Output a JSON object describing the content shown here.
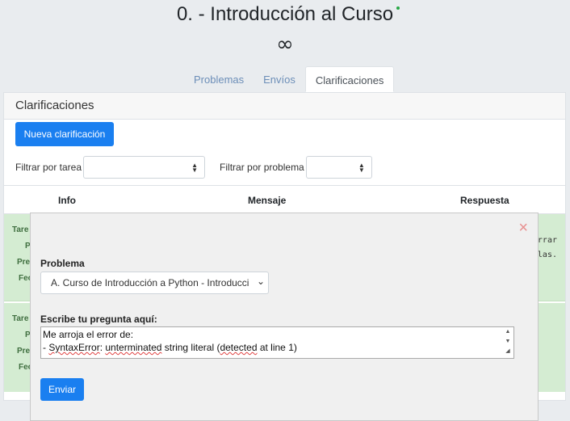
{
  "header": {
    "course_title": "0. - Introducción al Curso",
    "timer": "∞"
  },
  "tabs": [
    {
      "label": "Problemas",
      "active": false
    },
    {
      "label": "Envíos",
      "active": false
    },
    {
      "label": "Clarificaciones",
      "active": true
    }
  ],
  "panel": {
    "title": "Clarificaciones",
    "new_button": "Nueva clarificación",
    "filter_task_label": "Filtrar por tarea",
    "filter_problem_label": "Filtrar por problema"
  },
  "table": {
    "columns": [
      "Info",
      "Mensaje",
      "Respuesta"
    ],
    "rows": [
      {
        "labels": [
          "Tare",
          "P",
          "Pre",
          "Fec"
        ],
        "response": [
          "rrar",
          "las."
        ]
      },
      {
        "labels": [
          "Tare",
          "P",
          "Pre",
          "Fec"
        ],
        "response": []
      }
    ]
  },
  "modal": {
    "close_icon": "×",
    "problem_label": "Problema",
    "problem_value": "A. Curso de Introducción a Python - Introducci",
    "question_label": "Escribe tu pregunta aquí:",
    "question_line1": "Me arroja el error de:",
    "question_line2_prefix": "- ",
    "question_line2_word1": "SyntaxError",
    "question_line2_mid1": ": ",
    "question_line2_word2": "unterminated",
    "question_line2_mid2": " string literal (",
    "question_line2_word3": "detected",
    "question_line2_suffix": " at line 1)",
    "send_button": "Enviar"
  },
  "colors": {
    "primary": "#1a7ff0",
    "row_success": "#d4ecd2",
    "online": "#28a745"
  }
}
